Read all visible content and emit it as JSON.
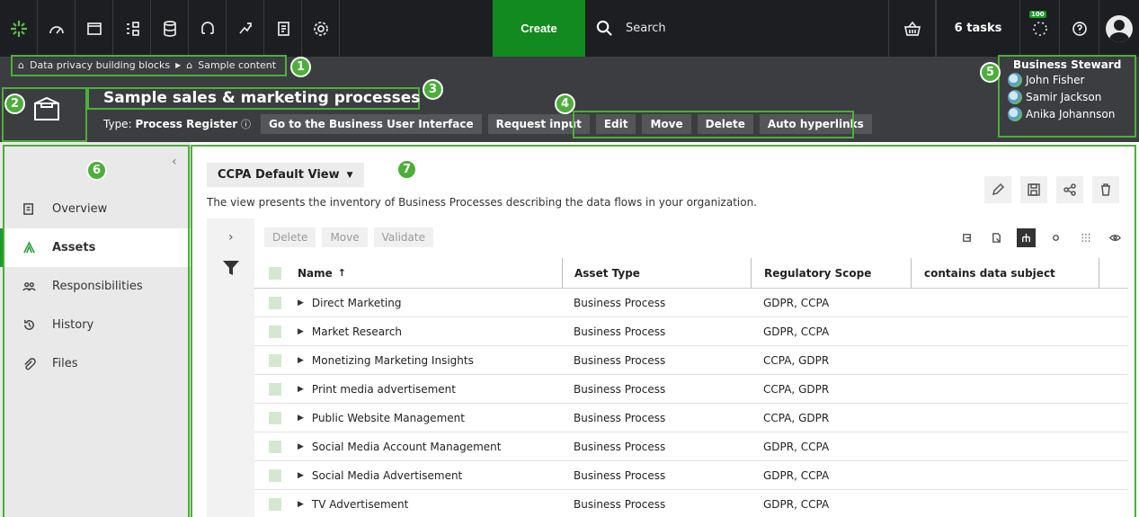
{
  "nav": {
    "icons": [
      "app-logo-icon",
      "dashboard-icon",
      "browse-icon",
      "diagram-icon",
      "database-icon",
      "catalog-icon",
      "lineage-icon",
      "reports-icon",
      "settings-icon"
    ],
    "create_label": "Create",
    "search_placeholder": "Search",
    "tasks_label": "6 tasks",
    "notifications_badge": "100",
    "accent": "#128a20"
  },
  "header": {
    "breadcrumb": [
      "Data privacy building blocks",
      "Sample content"
    ],
    "title": "Sample sales & marketing processes",
    "type_label": "Type:",
    "type_value": "Process Register",
    "buttons": [
      "Go to the Business User Interface",
      "Request input",
      "Edit",
      "Move",
      "Delete",
      "Auto hyperlinks"
    ],
    "steward_label": "Business Steward",
    "stewards": [
      "John Fisher",
      "Samir Jackson",
      "Anika Johannson"
    ],
    "callouts": [
      "1",
      "2",
      "3",
      "4",
      "5",
      "6",
      "7"
    ],
    "callout_color": "#4caf3a"
  },
  "sidebar": {
    "items": [
      {
        "label": "Overview",
        "icon": "overview-icon"
      },
      {
        "label": "Assets",
        "icon": "assets-icon"
      },
      {
        "label": "Responsibilities",
        "icon": "responsibilities-icon"
      },
      {
        "label": "History",
        "icon": "history-icon"
      },
      {
        "label": "Files",
        "icon": "paperclip-icon"
      }
    ],
    "active": "Assets"
  },
  "main": {
    "view_name": "CCPA Default View",
    "view_description": "The view presents the inventory of Business Processes describing the data flows in your organization.",
    "actions": [
      "Delete",
      "Move",
      "Validate"
    ],
    "columns": [
      "Name",
      "Asset Type",
      "Regulatory Scope",
      "contains data subject"
    ],
    "sort_indicator": "↑",
    "rows": [
      {
        "name": "Direct Marketing",
        "type": "Business Process",
        "scope": "GDPR, CCPA",
        "subject": ""
      },
      {
        "name": "Market Research",
        "type": "Business Process",
        "scope": "GDPR, CCPA",
        "subject": ""
      },
      {
        "name": "Monetizing Marketing Insights",
        "type": "Business Process",
        "scope": "CCPA, GDPR",
        "subject": ""
      },
      {
        "name": "Print media advertisement",
        "type": "Business Process",
        "scope": "CCPA, GDPR",
        "subject": ""
      },
      {
        "name": "Public Website Management",
        "type": "Business Process",
        "scope": "CCPA, GDPR",
        "subject": ""
      },
      {
        "name": "Social Media Account Management",
        "type": "Business Process",
        "scope": "GDPR, CCPA",
        "subject": ""
      },
      {
        "name": "Social Media Advertisement",
        "type": "Business Process",
        "scope": "GDPR, CCPA",
        "subject": ""
      },
      {
        "name": "TV Advertisement",
        "type": "Business Process",
        "scope": "GDPR, CCPA",
        "subject": ""
      }
    ]
  }
}
